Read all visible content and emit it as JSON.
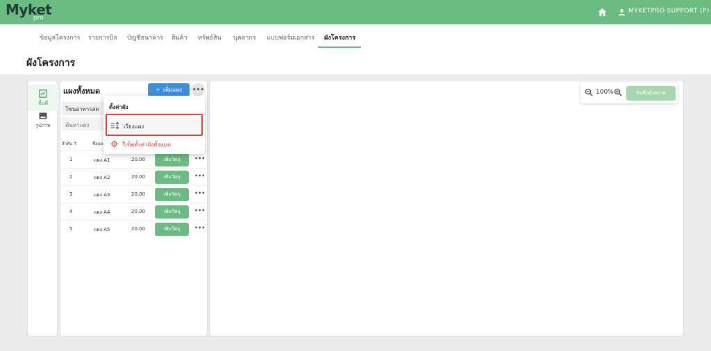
{
  "brand": {
    "name": "Myket",
    "sub": "pro"
  },
  "header": {
    "user": "MYKETPRO SUPPORT (P)"
  },
  "nav": {
    "tabs": [
      "ข้อมูลโครงการ",
      "รายการบิล",
      "บัญชีธนาคาร",
      "สินค้า",
      "ทรัพย์สิน",
      "บุคลากร",
      "แบบฟอร์มเอกสาร",
      "ผังโครงการ"
    ],
    "active_index": 7
  },
  "page": {
    "title": "ผังโครงการ"
  },
  "leftbar": {
    "items": [
      "พื้นที่",
      "รูปภาพ"
    ]
  },
  "panel": {
    "title": "แผงทั้งหมด",
    "add_button": "เพิ่มแผง",
    "zone": "โซนอาหารสด",
    "search_placeholder": "ค้นหาแผง",
    "columns": {
      "order": "ลำดับ ↑",
      "name": "ชื่อแผง"
    },
    "rows": [
      {
        "no": "1",
        "name": "แผง A1",
        "size": "20.00",
        "action": "เพิ่มวัตถุ"
      },
      {
        "no": "2",
        "name": "แผง A2",
        "size": "20.00",
        "action": "เพิ่มวัตถุ"
      },
      {
        "no": "3",
        "name": "แผง A3",
        "size": "20.00",
        "action": "เพิ่มวัตถุ"
      },
      {
        "no": "4",
        "name": "แผง A4",
        "size": "20.00",
        "action": "เพิ่มวัตถุ"
      },
      {
        "no": "5",
        "name": "แผง A5",
        "size": "20.00",
        "action": "เพิ่มวัตถุ"
      }
    ]
  },
  "menu": {
    "header": "ตั้งค่าผัง",
    "sort_label": "เรียงแผง",
    "reset_label": "รีเซ็ตตั้งค่าผังทั้งหมด"
  },
  "zoom": {
    "level": "100%",
    "save_label": "บันทึกผังตลาด"
  },
  "colors": {
    "brand_green": "#6cbb82",
    "primary_blue": "#3d8fdb",
    "danger": "#d9463a"
  }
}
